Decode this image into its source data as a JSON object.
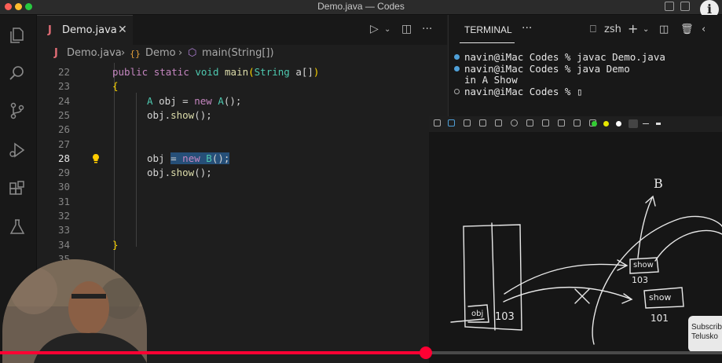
{
  "window": {
    "title": "Demo.java — Codes",
    "info_label": "i"
  },
  "activity_bar": {
    "items": [
      "explorer",
      "search",
      "source-control",
      "run-debug",
      "extensions",
      "testing"
    ]
  },
  "editor": {
    "tab": {
      "icon": "J",
      "label": "Demo.java",
      "close": "✕"
    },
    "actions": {
      "run": "▷",
      "split": "◫",
      "more": "···"
    },
    "breadcrumb": [
      {
        "icon": "J",
        "label": "Demo.java"
      },
      {
        "icon": "{}",
        "label": "Demo"
      },
      {
        "icon": "⬡",
        "label": "main(String[])"
      }
    ],
    "lines": [
      {
        "n": "22",
        "tokens": [
          [
            "kw",
            "public "
          ],
          [
            "kw",
            "static "
          ],
          [
            "ty",
            "void "
          ],
          [
            "fn",
            "main"
          ],
          [
            "br",
            "("
          ],
          [
            "ty",
            "String "
          ],
          [
            "pl",
            "a[]"
          ],
          [
            "br",
            ")"
          ]
        ]
      },
      {
        "n": "23",
        "tokens": [
          [
            "br",
            "{"
          ]
        ]
      },
      {
        "n": "24",
        "tokens": [
          [
            "ty",
            "A "
          ],
          [
            "pl",
            "obj = "
          ],
          [
            "kw",
            "new "
          ],
          [
            "ty",
            "A"
          ],
          [
            "pl",
            "();"
          ]
        ]
      },
      {
        "n": "25",
        "tokens": [
          [
            "pl",
            "obj."
          ],
          [
            "fn",
            "show"
          ],
          [
            "pl",
            "();"
          ]
        ]
      },
      {
        "n": "26",
        "tokens": []
      },
      {
        "n": "27",
        "tokens": []
      },
      {
        "n": "28",
        "tokens": [
          [
            "pl",
            "obj "
          ],
          [
            "pl",
            "= "
          ],
          [
            "kw",
            "new "
          ],
          [
            "ty",
            "B"
          ],
          [
            "pl",
            "();"
          ]
        ]
      },
      {
        "n": "29",
        "tokens": [
          [
            "pl",
            "obj."
          ],
          [
            "fn",
            "show"
          ],
          [
            "pl",
            "();"
          ]
        ]
      },
      {
        "n": "30",
        "tokens": []
      },
      {
        "n": "31",
        "tokens": []
      },
      {
        "n": "32",
        "tokens": []
      },
      {
        "n": "33",
        "tokens": []
      },
      {
        "n": "34",
        "tokens": [
          [
            "br",
            "}"
          ]
        ]
      },
      {
        "n": "35",
        "tokens": []
      }
    ]
  },
  "terminal": {
    "tab_label": "TERMINAL",
    "more": "···",
    "shell": "zsh",
    "lines": [
      {
        "dot": "#4fa0d8",
        "text": "navin@iMac Codes % javac Demo.java"
      },
      {
        "dot": "#4fa0d8",
        "text": "navin@iMac Codes % java Demo"
      },
      {
        "dot": "",
        "text": "in A Show"
      },
      {
        "dot": "hollow",
        "text": "navin@iMac Codes % ▯"
      }
    ]
  },
  "whiteboard": {
    "label_b": "B",
    "box_show_top": "show",
    "addr_103_top": "103",
    "box_show_mid": "show",
    "addr_101": "101",
    "obj_label": "obj",
    "obj_value": "103",
    "swatch_colors": [
      "#33cc33",
      "#e6e600",
      "#ffffff"
    ]
  },
  "overlay": {
    "subscribe_line1": "Subscrib",
    "subscribe_line2": "Telusko",
    "progress": 0.59
  }
}
